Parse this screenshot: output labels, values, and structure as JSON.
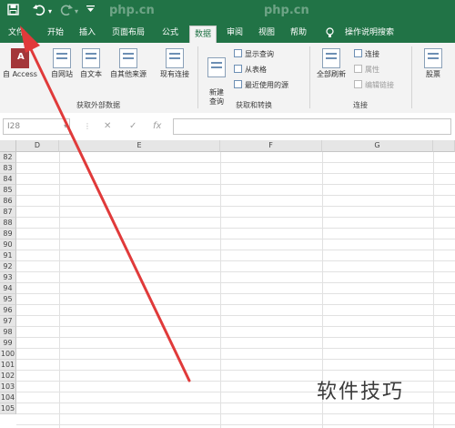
{
  "quick_access": {
    "save": "💾",
    "undo": "↶",
    "redo": "↷",
    "customize": "▾"
  },
  "tabs": [
    "文件",
    "开始",
    "插入",
    "页面布局",
    "公式",
    "数据",
    "审阅",
    "视图",
    "帮助",
    "操作说明搜索"
  ],
  "active_tab": "数据",
  "ribbon": {
    "get_external": {
      "label": "获取外部数据",
      "buttons": [
        "自 Access",
        "自网站",
        "自文本",
        "自其他来源",
        "现有连接"
      ]
    },
    "get_transform": {
      "label": "获取和转换",
      "new_query": "新建\n查询",
      "small": [
        "显示查询",
        "从表格",
        "最近使用的源"
      ]
    },
    "connections": {
      "label": "连接",
      "refresh_all": "全部刷新",
      "small": [
        "连接",
        "属性",
        "编辑链接"
      ]
    },
    "data_types": {
      "stocks": "股票"
    }
  },
  "formula_bar": {
    "name_box": "I28",
    "cancel": "✕",
    "enter": "✓",
    "fx": "fx"
  },
  "columns": [
    "D",
    "E",
    "F",
    "G"
  ],
  "rows": [
    "82",
    "83",
    "84",
    "85",
    "86",
    "87",
    "88",
    "89",
    "90",
    "91",
    "92",
    "93",
    "94",
    "95",
    "96",
    "97",
    "98",
    "99",
    "100",
    "101",
    "102",
    "103",
    "104",
    "105"
  ],
  "watermark": "软件技巧",
  "php_watermark": "php.cn",
  "colors": {
    "excel_green": "#217346",
    "arrow_red": "#e03a3a"
  }
}
